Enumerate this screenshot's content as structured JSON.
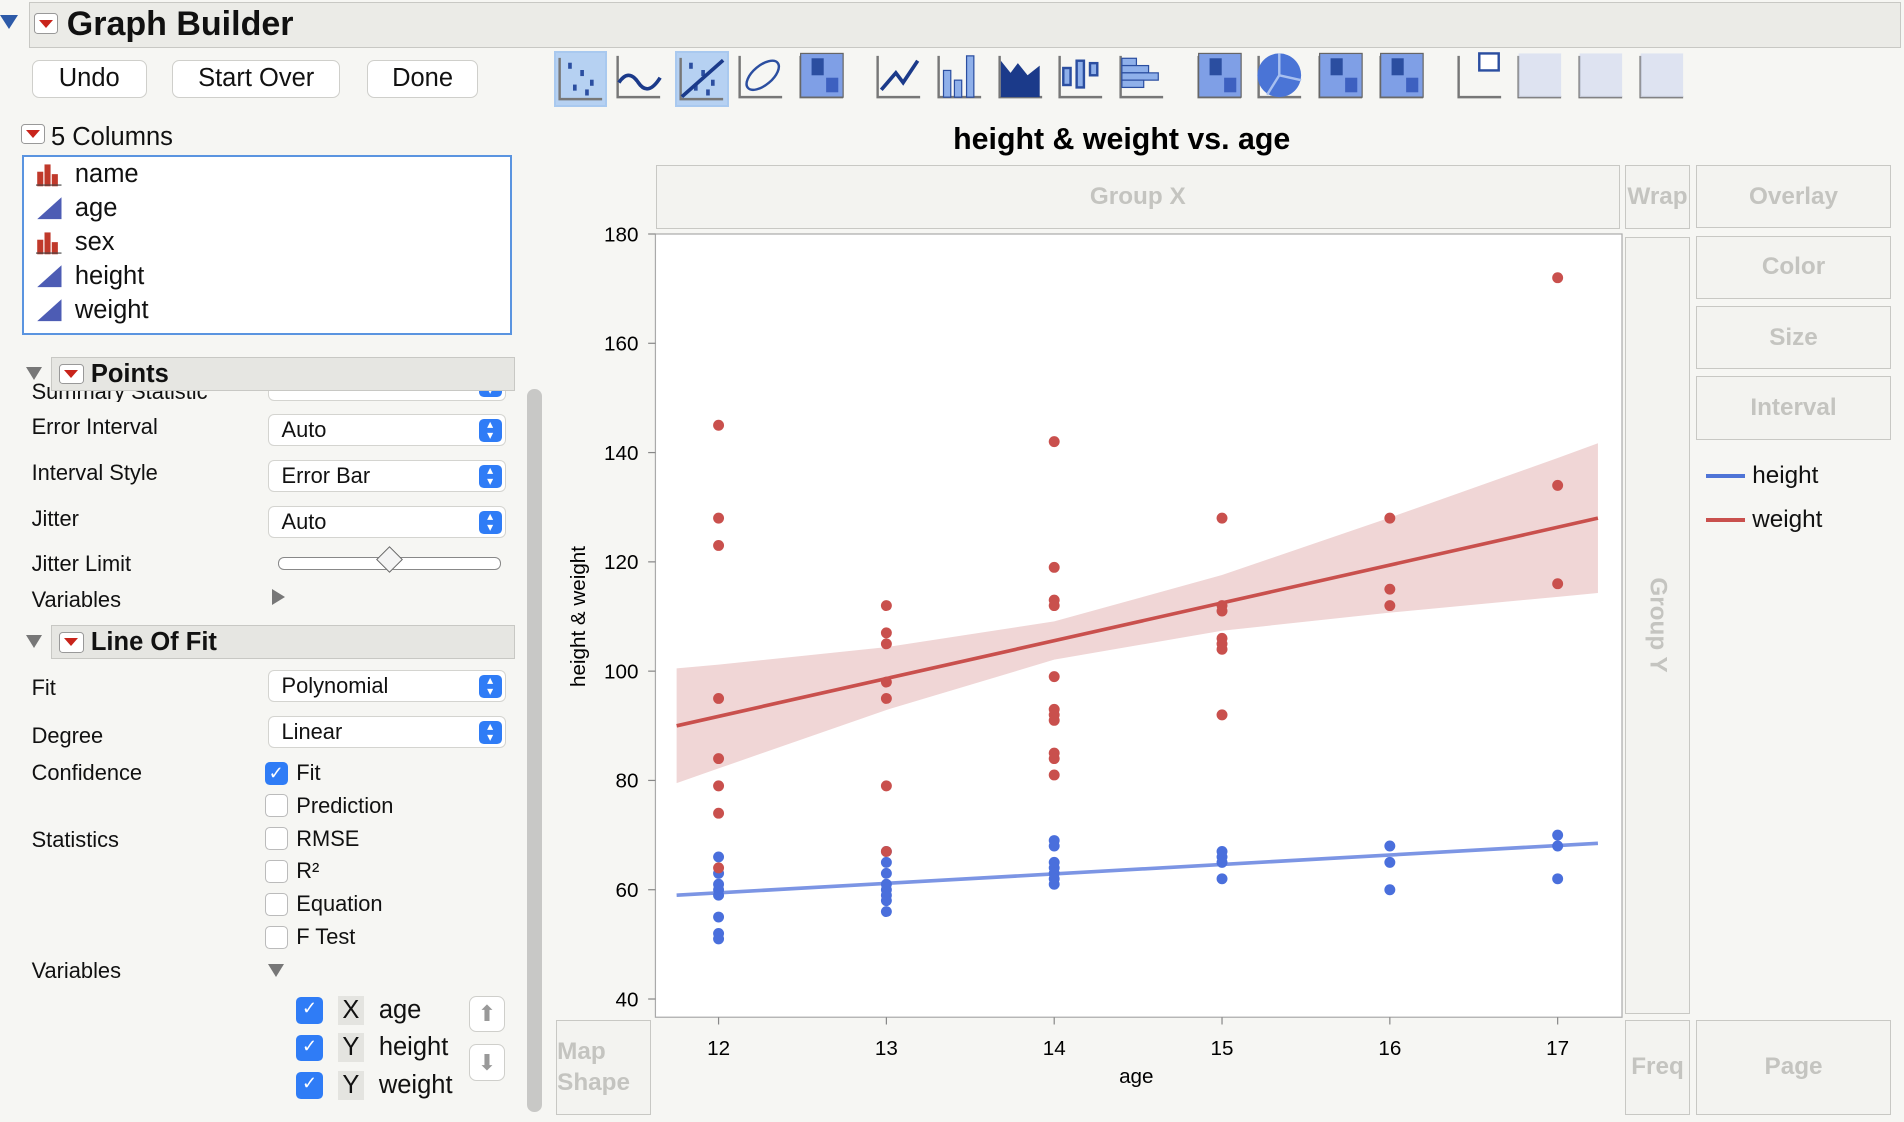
{
  "window": {
    "title": "Graph Builder"
  },
  "buttons": {
    "undo": "Undo",
    "start_over": "Start Over",
    "done": "Done"
  },
  "toolbar": {
    "icons": [
      "points",
      "smoother",
      "line-of-fit",
      "ellipse",
      "contour",
      "line",
      "bar",
      "area",
      "box-plot",
      "histogram",
      "heatmap",
      "pie",
      "treemap",
      "mosaic",
      "caption-box",
      "formula",
      "map-shapes",
      "parallel"
    ],
    "selected": [
      "points",
      "line-of-fit"
    ]
  },
  "columns": {
    "header": "5 Columns",
    "items": [
      {
        "name": "name",
        "type": "nominal"
      },
      {
        "name": "age",
        "type": "continuous"
      },
      {
        "name": "sex",
        "type": "nominal"
      },
      {
        "name": "height",
        "type": "continuous"
      },
      {
        "name": "weight",
        "type": "continuous"
      }
    ]
  },
  "points_section": {
    "title": "Points",
    "cut_label": "Summary Statistic",
    "rows": [
      {
        "label": "Error Interval",
        "value": "Auto"
      },
      {
        "label": "Interval Style",
        "value": "Error Bar"
      },
      {
        "label": "Jitter",
        "value": "Auto"
      }
    ],
    "jitter_limit_label": "Jitter Limit",
    "jitter_limit": 0.5,
    "variables_label": "Variables"
  },
  "fit_section": {
    "title": "Line Of Fit",
    "rows": [
      {
        "label": "Fit",
        "value": "Polynomial"
      },
      {
        "label": "Degree",
        "value": "Linear"
      }
    ],
    "confidence_label": "Confidence",
    "statistics_label": "Statistics",
    "confidence": [
      {
        "label": "Fit",
        "checked": true
      },
      {
        "label": "Prediction",
        "checked": false
      }
    ],
    "statistics": [
      {
        "label": "RMSE",
        "checked": false
      },
      {
        "label": "R²",
        "checked": false
      },
      {
        "label": "Equation",
        "checked": false
      },
      {
        "label": "F Test",
        "checked": false
      }
    ],
    "variables_label": "Variables",
    "variables": [
      {
        "role": "X",
        "name": "age",
        "checked": true
      },
      {
        "role": "Y",
        "name": "height",
        "checked": true
      },
      {
        "role": "Y",
        "name": "weight",
        "checked": true
      }
    ]
  },
  "zones": {
    "group_x": "Group X",
    "group_y": "Group Y",
    "wrap": "Wrap",
    "overlay": "Overlay",
    "color": "Color",
    "size": "Size",
    "interval": "Interval",
    "map_shape": "Map Shape",
    "freq": "Freq",
    "page": "Page"
  },
  "chart_data": {
    "type": "scatter",
    "title": "height & weight vs. age",
    "xlabel": "age",
    "ylabel": "height & weight",
    "xlim": [
      11.62,
      17.38
    ],
    "ylim": [
      39,
      181
    ],
    "xticks": [
      12,
      13,
      14,
      15,
      16,
      17
    ],
    "yticks": [
      40,
      60,
      80,
      100,
      120,
      140,
      160,
      180
    ],
    "legend": [
      {
        "name": "height",
        "color": "#4f74d6"
      },
      {
        "name": "weight",
        "color": "#c9504d"
      }
    ],
    "legend_position": "right",
    "series": [
      {
        "name": "height",
        "color": "#4a6fdc",
        "points": [
          [
            12,
            66
          ],
          [
            12,
            63
          ],
          [
            12,
            61
          ],
          [
            12,
            60
          ],
          [
            12,
            59
          ],
          [
            12,
            55
          ],
          [
            12,
            52
          ],
          [
            12,
            51
          ],
          [
            13,
            67
          ],
          [
            13,
            65
          ],
          [
            13,
            63
          ],
          [
            13,
            61
          ],
          [
            13,
            60
          ],
          [
            13,
            59
          ],
          [
            13,
            58
          ],
          [
            13,
            56
          ],
          [
            14,
            69
          ],
          [
            14,
            68
          ],
          [
            14,
            65
          ],
          [
            14,
            64
          ],
          [
            14,
            63
          ],
          [
            14,
            62
          ],
          [
            14,
            61
          ],
          [
            15,
            67
          ],
          [
            15,
            66
          ],
          [
            15,
            65
          ],
          [
            15,
            62
          ],
          [
            16,
            68
          ],
          [
            16,
            65
          ],
          [
            16,
            60
          ],
          [
            17,
            70
          ],
          [
            17,
            68
          ],
          [
            17,
            62
          ]
        ],
        "fit": [
          [
            11.75,
            59
          ],
          [
            17.24,
            68.5
          ]
        ],
        "fit_color": "#7c95e4"
      },
      {
        "name": "weight",
        "color": "#c9504d",
        "points": [
          [
            12,
            145
          ],
          [
            12,
            128
          ],
          [
            12,
            123
          ],
          [
            12,
            95
          ],
          [
            12,
            84
          ],
          [
            12,
            79
          ],
          [
            12,
            74
          ],
          [
            12,
            64
          ],
          [
            13,
            112
          ],
          [
            13,
            107
          ],
          [
            13,
            105
          ],
          [
            13,
            98
          ],
          [
            13,
            95
          ],
          [
            13,
            79
          ],
          [
            13,
            67
          ],
          [
            14,
            142
          ],
          [
            14,
            119
          ],
          [
            14,
            113
          ],
          [
            14,
            112
          ],
          [
            14,
            99
          ],
          [
            14,
            93
          ],
          [
            14,
            92
          ],
          [
            14,
            91
          ],
          [
            14,
            85
          ],
          [
            14,
            84
          ],
          [
            14,
            81
          ],
          [
            15,
            128
          ],
          [
            15,
            112
          ],
          [
            15,
            111
          ],
          [
            15,
            106
          ],
          [
            15,
            105
          ],
          [
            15,
            104
          ],
          [
            15,
            92
          ],
          [
            16,
            128
          ],
          [
            16,
            115
          ],
          [
            16,
            112
          ],
          [
            17,
            172
          ],
          [
            17,
            134
          ],
          [
            17,
            116
          ]
        ],
        "fit": [
          [
            11.75,
            90
          ],
          [
            17.24,
            128
          ]
        ],
        "fit_color": "#c9504d",
        "band": {
          "x": [
            11.75,
            12,
            13,
            14,
            15,
            16,
            17,
            17.24
          ],
          "lower": [
            79.5,
            82.2,
            92.9,
            102.1,
            107.4,
            110.7,
            113.6,
            114.3
          ],
          "upper": [
            100.5,
            101.2,
            104.4,
            109.1,
            117.6,
            128.1,
            139,
            141.7
          ],
          "color": "#f0d6d6"
        }
      }
    ]
  }
}
